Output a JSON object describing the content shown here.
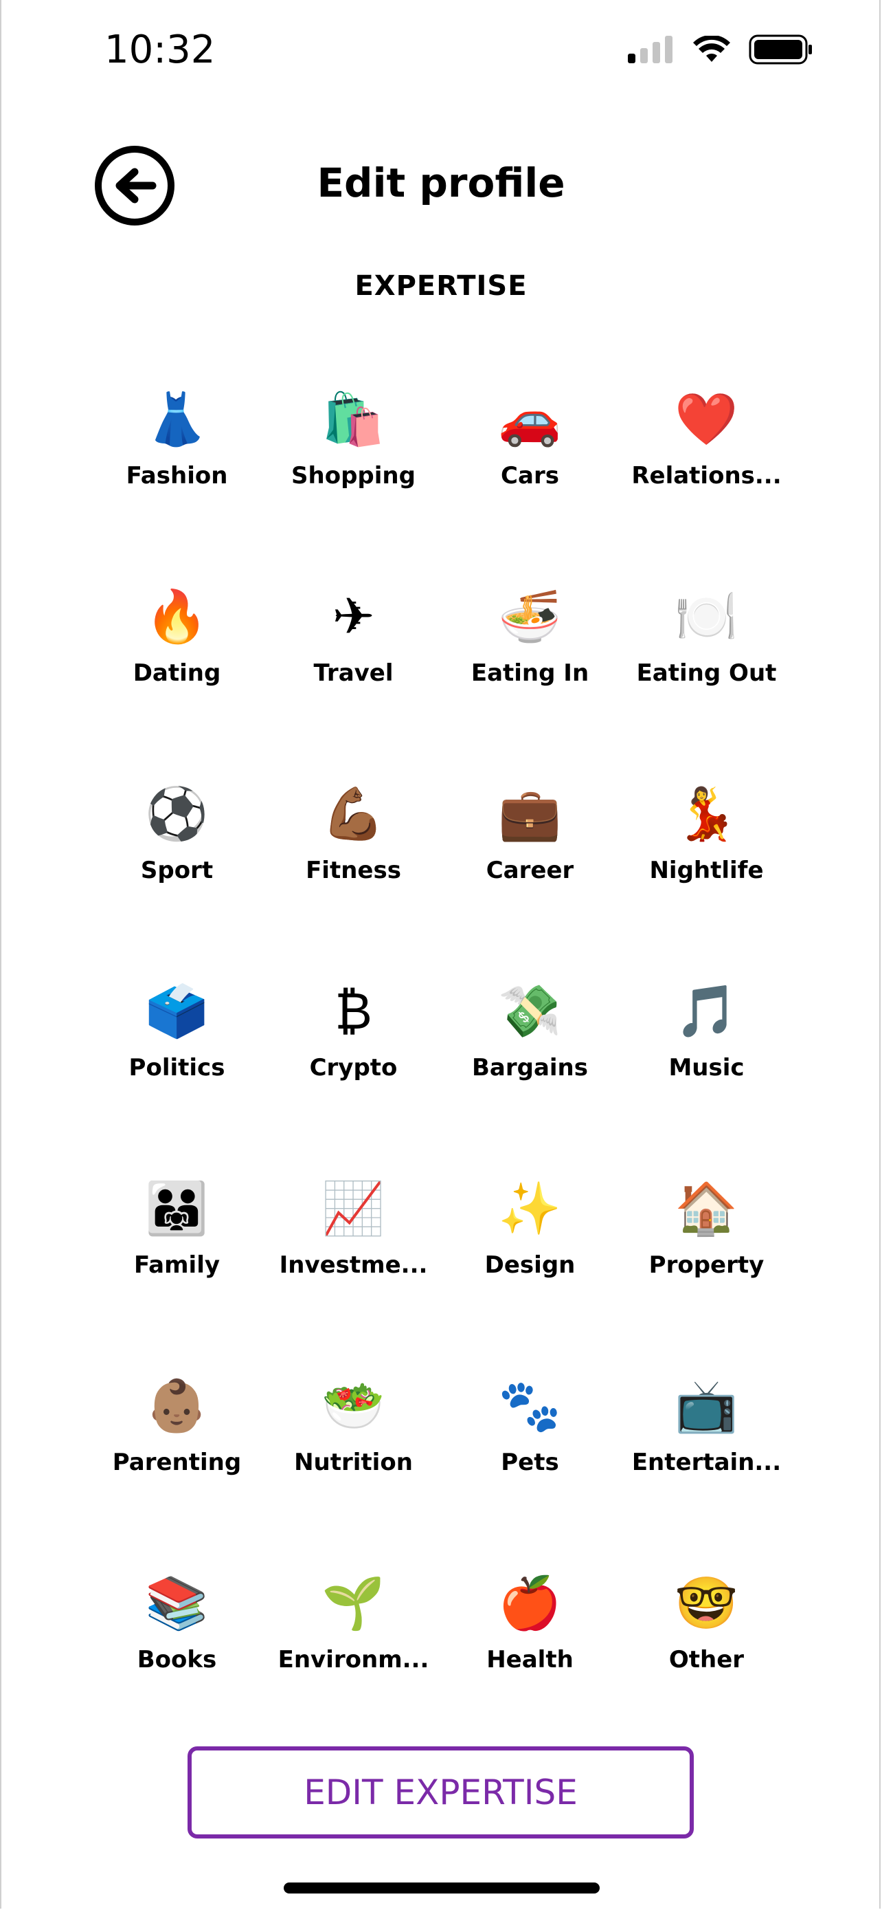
{
  "status_bar": {
    "time": "10:32",
    "signal_icon": "cellular-signal-icon",
    "wifi_icon": "wifi-icon",
    "battery_icon": "battery-icon"
  },
  "header": {
    "back_icon": "arrow-left-circle-icon",
    "title": "Edit profile"
  },
  "section": {
    "title": "EXPERTISE"
  },
  "expertise_items": [
    {
      "emoji": "👗",
      "label": "Fashion"
    },
    {
      "emoji": "🛍️",
      "label": "Shopping"
    },
    {
      "emoji": "🚗",
      "label": "Cars"
    },
    {
      "emoji": "❤️",
      "label": "Relations..."
    },
    {
      "emoji": "🔥",
      "label": "Dating"
    },
    {
      "emoji": "✈",
      "label": "Travel"
    },
    {
      "emoji": "🍜",
      "label": "Eating In"
    },
    {
      "emoji": "🍽️",
      "label": "Eating Out"
    },
    {
      "emoji": "⚽",
      "label": "Sport"
    },
    {
      "emoji": "💪🏾",
      "label": "Fitness"
    },
    {
      "emoji": "💼",
      "label": "Career"
    },
    {
      "emoji": "💃",
      "label": "Nightlife"
    },
    {
      "emoji": "🗳️",
      "label": "Politics"
    },
    {
      "emoji": "₿",
      "label": "Crypto"
    },
    {
      "emoji": "💸",
      "label": "Bargains"
    },
    {
      "emoji": "🎵",
      "label": "Music"
    },
    {
      "emoji": "👨‍👨‍👧",
      "label": "Family"
    },
    {
      "emoji": "📈",
      "label": "Investme..."
    },
    {
      "emoji": "✨",
      "label": "Design"
    },
    {
      "emoji": "🏠",
      "label": "Property"
    },
    {
      "emoji": "👶🏽",
      "label": "Parenting"
    },
    {
      "emoji": "🥗",
      "label": "Nutrition"
    },
    {
      "emoji": "🐾",
      "label": "Pets"
    },
    {
      "emoji": "📺",
      "label": "Entertain..."
    },
    {
      "emoji": "📚",
      "label": "Books"
    },
    {
      "emoji": "🌱",
      "label": "Environm..."
    },
    {
      "emoji": "🍎",
      "label": "Health"
    },
    {
      "emoji": "🤓",
      "label": "Other"
    }
  ],
  "edit_button": {
    "label": "EDIT EXPERTISE"
  },
  "colors": {
    "accent": "#7b2aa8",
    "text": "#000000",
    "background": "#ffffff"
  }
}
